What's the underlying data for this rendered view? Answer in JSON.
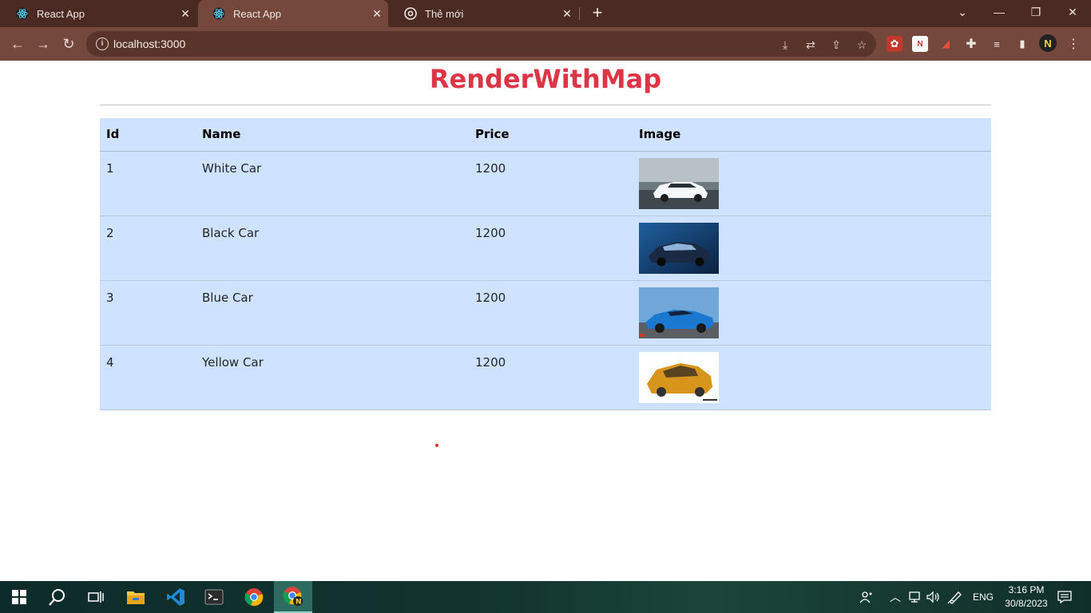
{
  "browser": {
    "tabs": [
      {
        "title": "React App",
        "active": false
      },
      {
        "title": "React App",
        "active": true
      },
      {
        "title": "Thẻ mới",
        "active": false
      }
    ],
    "url": "localhost:3000"
  },
  "page": {
    "title": "RenderWithMap",
    "table": {
      "headers": [
        "Id",
        "Name",
        "Price",
        "Image"
      ],
      "rows": [
        {
          "id": "1",
          "name": "White Car",
          "price": "1200",
          "image": "white-car-icon"
        },
        {
          "id": "2",
          "name": "Black Car",
          "price": "1200",
          "image": "black-car-icon"
        },
        {
          "id": "3",
          "name": "Blue Car",
          "price": "1200",
          "image": "blue-car-icon"
        },
        {
          "id": "4",
          "name": "Yellow Car",
          "price": "1200",
          "image": "yellow-car-icon"
        }
      ]
    }
  },
  "taskbar": {
    "language": "ENG",
    "time": "3:16 PM",
    "date": "30/8/2023"
  },
  "colors": {
    "title": "#dc3545",
    "table_bg": "#cfe2ff",
    "chrome_dark": "#4a2a22",
    "chrome_toolbar": "#74483d"
  }
}
